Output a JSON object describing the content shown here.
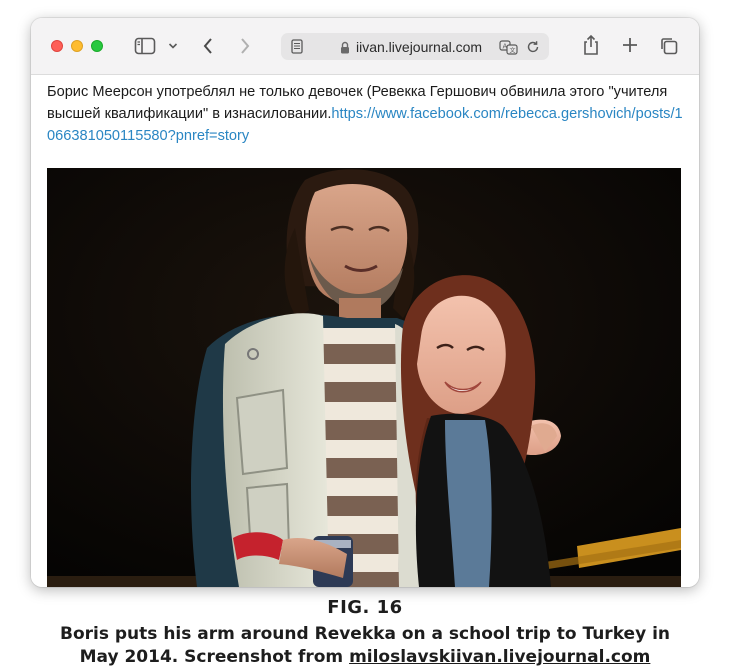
{
  "browser": {
    "url": "iivan.livejournal.com"
  },
  "post": {
    "text": "Борис Меерсон употреблял не только девочек (Ревекка Гершович обвинила этого \"учителя высшей квалификации\" в изнасиловании.",
    "link": "https://www.facebook.com/rebecca.gershovich/posts/1066381050115580?pnref=story"
  },
  "caption": {
    "fig": "FIG. 16",
    "line1": "Boris puts his arm around Revekka on a school trip to Turkey in",
    "line2_prefix": "May 2014. Screenshot from ",
    "line2_link": "miloslavskiivan.livejournal.com"
  },
  "colors": {
    "link": "#2a86c3",
    "close": "#fe5f57",
    "minimize": "#febc2e",
    "maximize": "#28c840"
  }
}
